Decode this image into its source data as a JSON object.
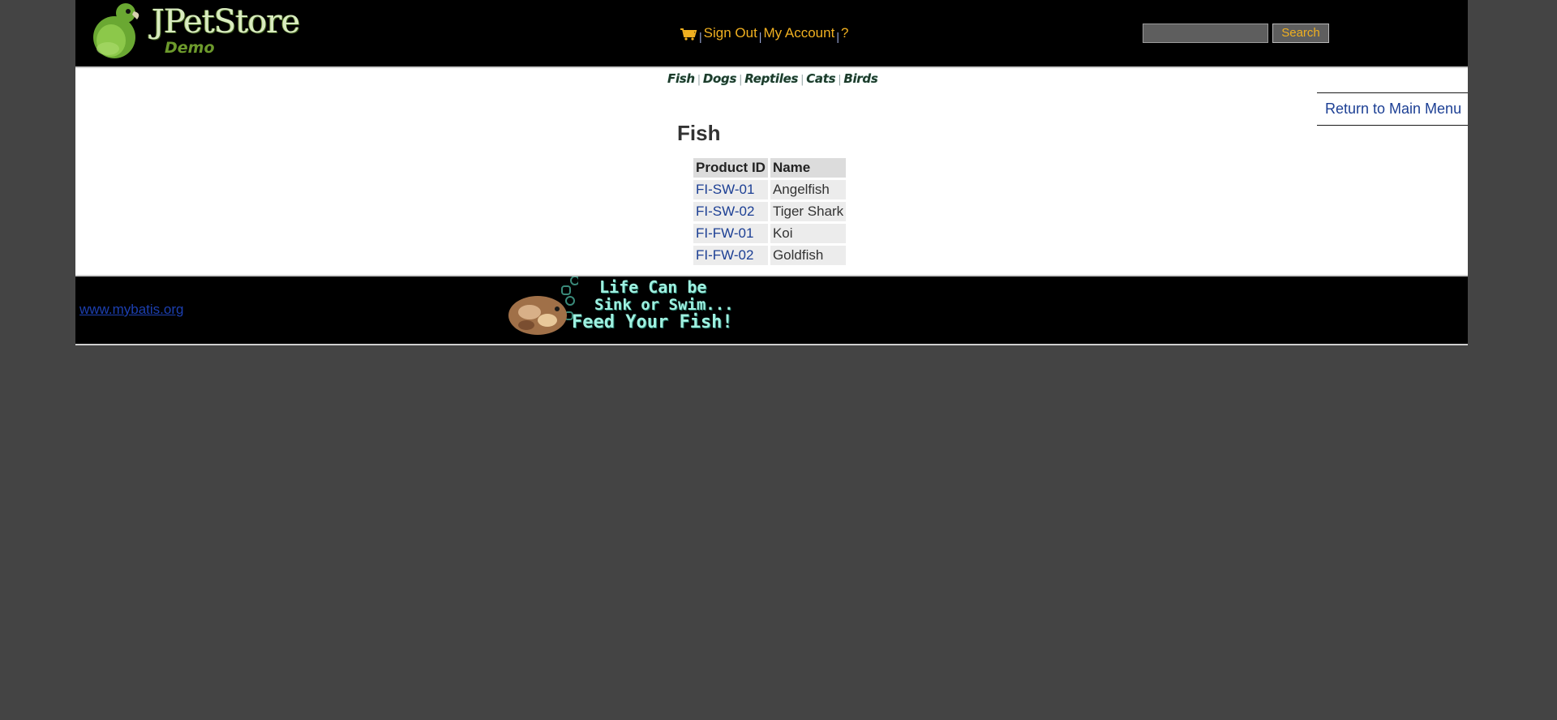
{
  "header": {
    "logo_title": "JPetStore",
    "logo_subtitle": "Demo",
    "menu": {
      "sign_out": "Sign Out",
      "my_account": "My Account",
      "help": "?",
      "separator": "|"
    },
    "search": {
      "placeholder": "",
      "button_label": "Search"
    }
  },
  "quicklinks": [
    "Fish",
    "Dogs",
    "Reptiles",
    "Cats",
    "Birds"
  ],
  "return_link": "Return to Main Menu",
  "category": {
    "title": "Fish",
    "columns": [
      "Product ID",
      "Name"
    ],
    "rows": [
      {
        "id": "FI-SW-01",
        "name": "Angelfish"
      },
      {
        "id": "FI-SW-02",
        "name": "Tiger Shark"
      },
      {
        "id": "FI-FW-01",
        "name": "Koi"
      },
      {
        "id": "FI-FW-02",
        "name": "Goldfish"
      }
    ]
  },
  "footer": {
    "link": "www.mybatis.org",
    "banner": {
      "line1": "Life Can be",
      "line2": "Sink or Swim...",
      "line3": "Feed Your Fish!"
    }
  },
  "colors": {
    "background": "#444444",
    "header_bg": "#000000",
    "menu_text": "#f0b020",
    "link": "#1c3f94"
  }
}
